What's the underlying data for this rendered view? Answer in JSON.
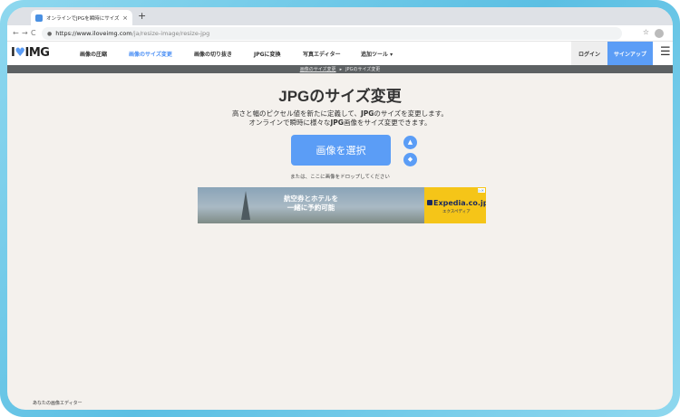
{
  "browser": {
    "tab_title": "オンラインでJPGを瞬時にサイズ変更",
    "tab_close": "×",
    "new_tab": "+",
    "back": "←",
    "forward": "→",
    "reload": "C",
    "url_host": "https://www.iloveimg.com",
    "url_path": "/ja/resize-image/resize-jpg",
    "bookmark": "☆"
  },
  "site": {
    "logo_left": "I",
    "logo_heart": "♥",
    "logo_right": "IMG",
    "nav": [
      {
        "label": "画像の圧縮",
        "active": false
      },
      {
        "label": "画像のサイズ変更",
        "active": true
      },
      {
        "label": "画像の切り抜き",
        "active": false
      },
      {
        "label": "JPGに変換",
        "active": false
      },
      {
        "label": "写真エディター",
        "active": false
      },
      {
        "label": "追加ツール ▾",
        "active": false
      }
    ],
    "login": "ログイン",
    "signup": "サインアップ",
    "menu_icon": "☰"
  },
  "breadcrumb": {
    "parent": "画像のサイズ変更",
    "separator": "▸",
    "current": "JPGのサイズ変更"
  },
  "main": {
    "title": "JPGのサイズ変更",
    "subtitle_line1_a": "高さと幅のピクセル値を新たに定義して、",
    "subtitle_line1_b": "JPG",
    "subtitle_line1_c": "のサイズを変更します。",
    "subtitle_line2_a": "オンラインで瞬時に様々な",
    "subtitle_line2_b": "JPG",
    "subtitle_line2_c": "画像をサイズ変更できます。",
    "select_button": "画像を選択",
    "gdrive_icon": "▲",
    "dropbox_icon": "◆",
    "drop_hint": "または、ここに画像をドロップしてください"
  },
  "ad": {
    "line1": "航空券とホテルを",
    "line2": "一緒に予約可能",
    "brand": "Expedia.co.jp",
    "brand_sub": "エクスペディア",
    "choice": "▷✕"
  },
  "status_bar": "あなたの画像エディター"
}
